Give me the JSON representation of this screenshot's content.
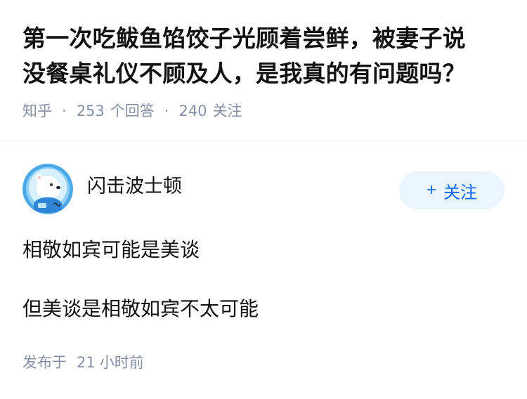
{
  "question": {
    "title_line1": "第一次吃鲅鱼馅饺子光顾着尝鲜，被妻子说",
    "title_line2": "没餐桌礼仪不顾及人，是我真的有问题吗？",
    "source": "知乎",
    "separator": "·",
    "answer_count": "253",
    "answer_label": "个回答",
    "follower_count": "240",
    "follower_label": "关注"
  },
  "answer": {
    "author_name": "闪击波士顿",
    "avatar_icon": "polar-bear-astronaut-avatar",
    "follow_plus": "+",
    "follow_label": "关注",
    "paragraphs": [
      "相敬如宾可能是美谈",
      "但美谈是相敬如宾不太可能"
    ],
    "publish_prefix": "发布于",
    "publish_num": "21",
    "publish_unit": "小时前"
  },
  "colors": {
    "meta_text": "#8590a6",
    "follow_bg": "#ebf5ff",
    "follow_text": "#0066ff",
    "avatar_bg": "#4aa8e8"
  }
}
